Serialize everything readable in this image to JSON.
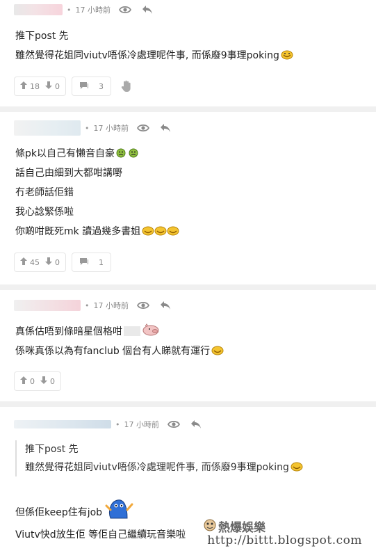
{
  "comments": [
    {
      "time": "17 小時前",
      "lines": [
        "推下post 先",
        "雖然覺得花姐同viutv唔係冷處理呢件事, 而係廢9事理poking"
      ],
      "up": "18",
      "down": "0",
      "replies": "3"
    },
    {
      "time": "17 小時前",
      "lines": [
        "條pk以自己有懶音自豪",
        "話自己由細到大都咁講嘢",
        "冇老師話佢錯",
        "我心諗緊係啦",
        "你啲咁既死mk 讀過幾多書姐"
      ],
      "up": "45",
      "down": "0",
      "replies": "1"
    },
    {
      "time": "17 小時前",
      "lines": [
        "真係估唔到條暗星個格咁",
        "係咪真係以為有fanclub 個台有人睇就有運行"
      ],
      "up": "0",
      "down": "0"
    },
    {
      "time": "17 小時前",
      "quote": [
        "推下post 先",
        "雖然覺得花姐同viutv唔係冷處理呢件事, 而係廢9事理poking"
      ],
      "lines": [
        "但係佢keep住有job",
        "Viutv快d放生佢 等佢自己繼續玩音樂啦"
      ]
    }
  ],
  "watermark": {
    "title": "熱爆娛樂",
    "url": "http://bittt.blogspot.com"
  },
  "icons": {
    "eye": "eye-icon",
    "reply": "reply-arrow-icon",
    "upvote": "arrow-up-icon",
    "downvote": "arrow-down-icon",
    "comment": "chat-bubble-icon",
    "hand": "hand-icon"
  }
}
